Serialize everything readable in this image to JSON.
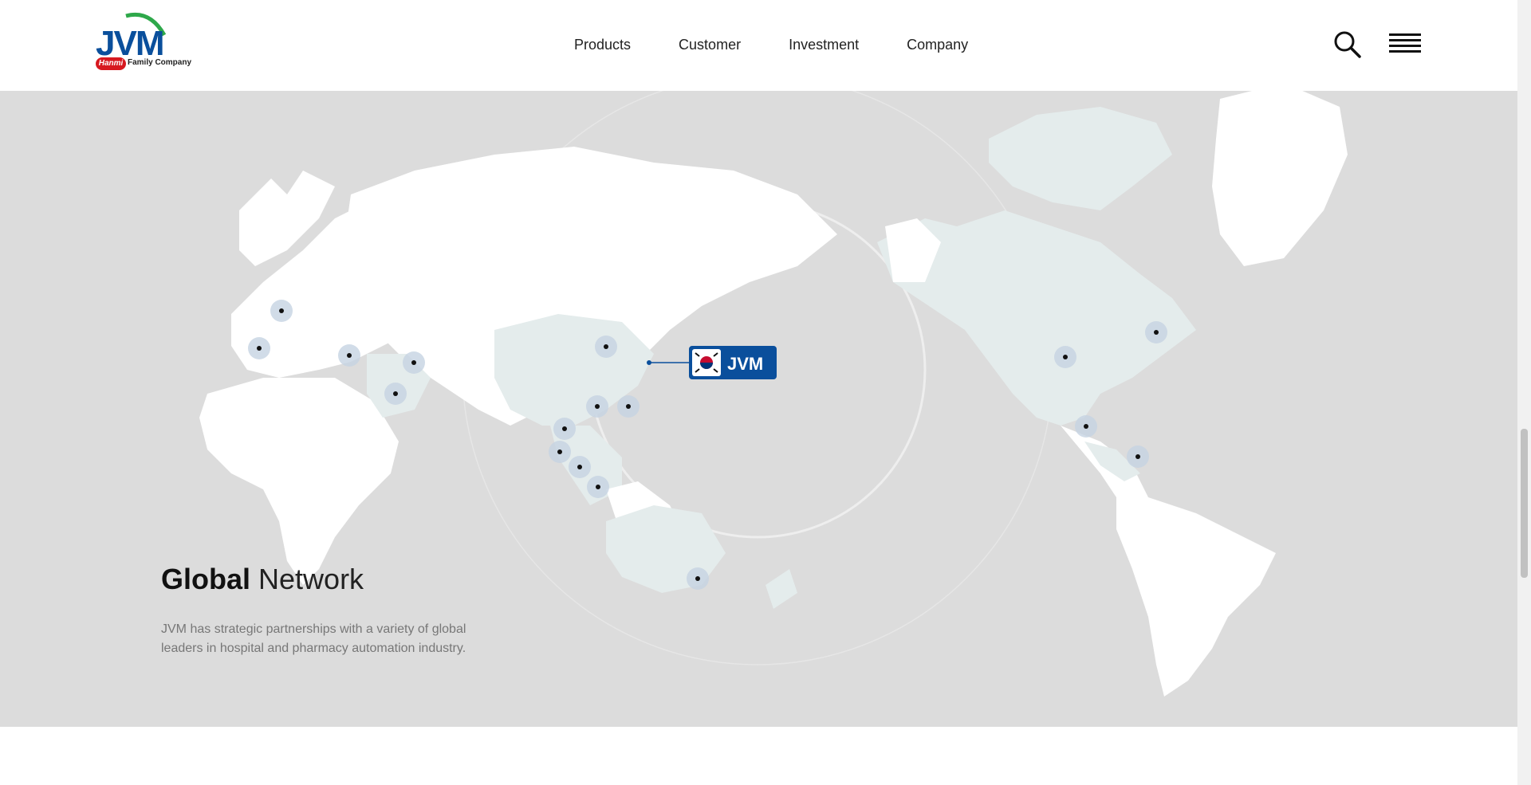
{
  "brand": {
    "logo_text": "JVM",
    "logo_badge": "Hanmi",
    "logo_tagline": "Family Company",
    "color_primary": "#0a4f9c",
    "color_accent": "#d71920"
  },
  "nav": {
    "items": [
      {
        "label": "Products"
      },
      {
        "label": "Customer"
      },
      {
        "label": "Investment"
      },
      {
        "label": "Company"
      }
    ]
  },
  "icons": {
    "search": "search-icon",
    "menu": "hamburger-menu-icon",
    "flag": "korea-flag-icon"
  },
  "section": {
    "title_bold": "Global",
    "title_light": "Network",
    "description": "JVM has strategic partnerships with a variety of global leaders in hospital and pharmacy automation industry."
  },
  "hq_badge": {
    "label": "JVM"
  }
}
